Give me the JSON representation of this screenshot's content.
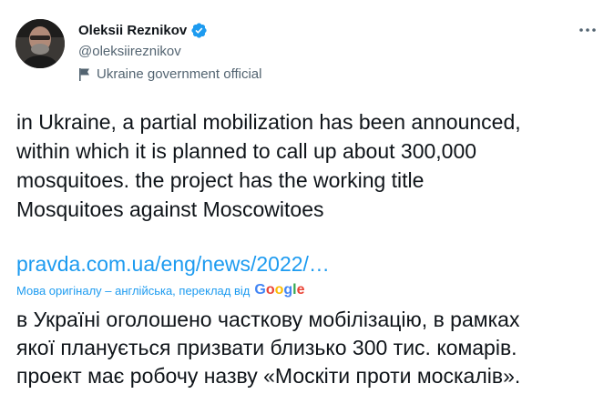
{
  "author": {
    "display_name": "Oleksii Reznikov",
    "handle": "@oleksiireznikov",
    "affiliation": "Ukraine government official",
    "verified_color": "#1d9bf0"
  },
  "tweet": {
    "text_lines": [
      "in Ukraine, a partial mobilization has been announced,",
      "within which it is planned to call up about 300,000",
      "mosquitoes. the project has the working title",
      "Mosquitoes against Moscowitoes"
    ],
    "link": "pravda.com.ua/eng/news/2022/…"
  },
  "translation": {
    "note": "Мова оригіналу – англійська, переклад від",
    "provider": "Google",
    "text_lines": [
      "в Україні оголошено часткову мобілізацію, в рамках",
      "якої планується призвати близько 300 тис. комарів.",
      "проект має робочу назву «Москіти проти москалів»."
    ]
  },
  "colors": {
    "link": "#1d9bf0",
    "secondary_text": "#536471",
    "primary_text": "#0f1419"
  },
  "icons": [
    "verified-badge-icon",
    "flag-icon",
    "more-options-icon"
  ]
}
